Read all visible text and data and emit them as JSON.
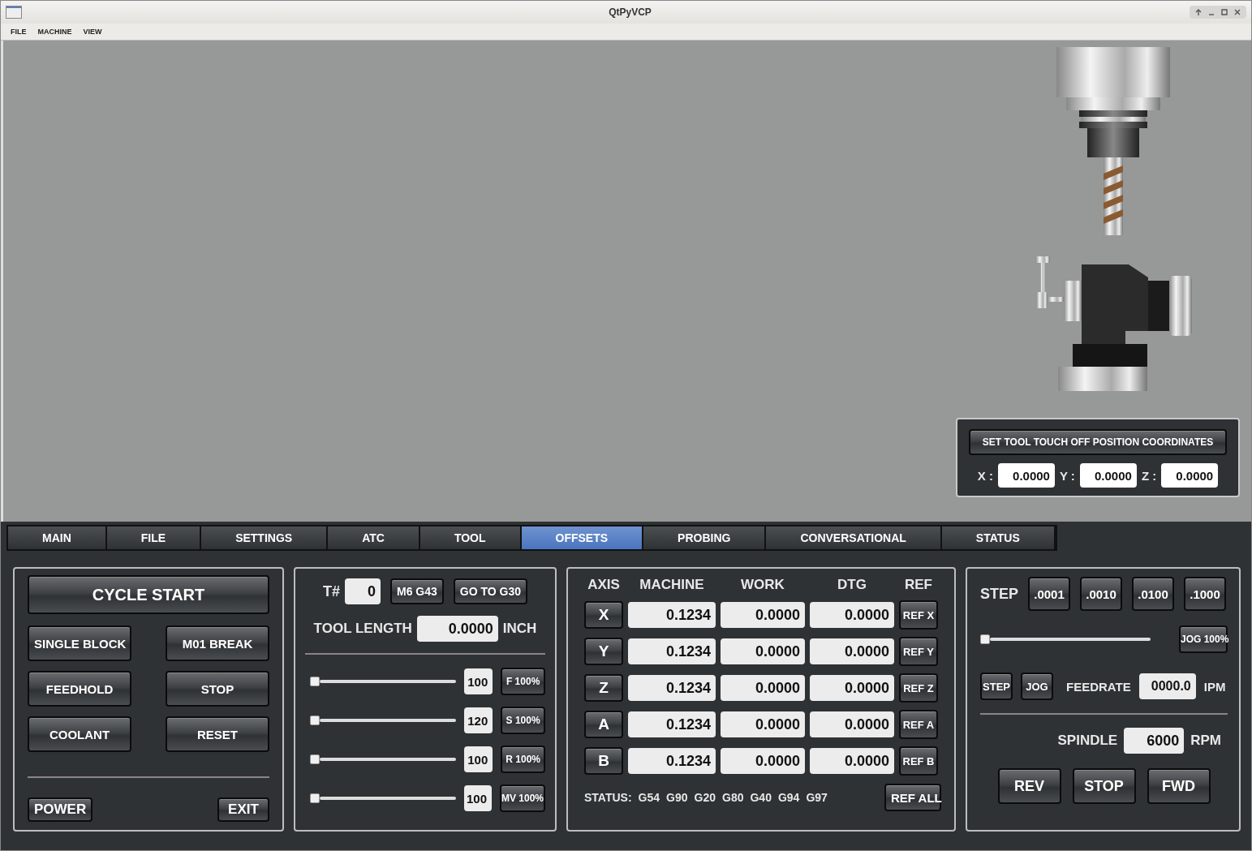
{
  "window": {
    "title": "QtPyVCP"
  },
  "menu": [
    "FILE",
    "MACHINE",
    "VIEW"
  ],
  "touch_off": {
    "button": "SET TOOL TOUCH OFF POSITION COORDINATES",
    "fields": [
      {
        "label": "X :",
        "value": "0.0000"
      },
      {
        "label": "Y :",
        "value": "0.0000"
      },
      {
        "label": "Z :",
        "value": "0.0000"
      }
    ]
  },
  "tabs": [
    {
      "label": "MAIN",
      "selected": false
    },
    {
      "label": "FILE",
      "selected": false
    },
    {
      "label": "SETTINGS",
      "selected": false
    },
    {
      "label": "ATC",
      "selected": false
    },
    {
      "label": "TOOL",
      "selected": false
    },
    {
      "label": "OFFSETS",
      "selected": true
    },
    {
      "label": "PROBING",
      "selected": false
    },
    {
      "label": "CONVERSATIONAL",
      "selected": false
    },
    {
      "label": "STATUS",
      "selected": false
    }
  ],
  "control_panel": {
    "cycle_start": "CYCLE START",
    "buttons": [
      "SINGLE BLOCK",
      "M01 BREAK",
      "FEEDHOLD",
      "STOP",
      "COOLANT",
      "RESET"
    ],
    "power": "POWER",
    "exit": "EXIT"
  },
  "tool_panel": {
    "tool_label": "T#",
    "tool_number": "0",
    "buttons": [
      "M6 G43",
      "GO TO G30"
    ],
    "length_label": "TOOL LENGTH",
    "length_value": "0.0000",
    "length_unit": "INCH",
    "overrides": [
      {
        "level": 0,
        "value": "100",
        "button": "F 100%"
      },
      {
        "level": 0,
        "value": "120",
        "button": "S 100%"
      },
      {
        "level": 0,
        "value": "100",
        "button": "R 100%"
      },
      {
        "level": 0,
        "value": "100",
        "button": "MV 100%"
      }
    ]
  },
  "dro": {
    "columns": [
      "AXIS",
      "MACHINE",
      "WORK",
      "DTG",
      "REF"
    ],
    "rows": [
      {
        "axis": "X",
        "machine": "0.1234",
        "work": "0.0000",
        "dtg": "0.0000",
        "ref": "REF X"
      },
      {
        "axis": "Y",
        "machine": "0.1234",
        "work": "0.0000",
        "dtg": "0.0000",
        "ref": "REF Y"
      },
      {
        "axis": "Z",
        "machine": "0.1234",
        "work": "0.0000",
        "dtg": "0.0000",
        "ref": "REF Z"
      },
      {
        "axis": "A",
        "machine": "0.1234",
        "work": "0.0000",
        "dtg": "0.0000",
        "ref": "REF A"
      },
      {
        "axis": "B",
        "machine": "0.1234",
        "work": "0.0000",
        "dtg": "0.0000",
        "ref": "REF B"
      }
    ],
    "status_label": "STATUS:",
    "codes": [
      "G54",
      "G90",
      "G20",
      "G80",
      "G40",
      "G94",
      "G97"
    ],
    "ref_all": "REF ALL"
  },
  "jog_panel": {
    "step_label": "STEP",
    "steps": [
      ".0001",
      ".0010",
      ".0100",
      ".1000"
    ],
    "jog_slider": {
      "level": 0
    },
    "jog_button": "JOG 100%",
    "mode_buttons": [
      "STEP",
      "JOG"
    ],
    "feedrate_label": "FEEDRATE",
    "feedrate_value": "0000.0",
    "feedrate_unit": "IPM",
    "spindle_label": "SPINDLE",
    "spindle_value": "6000",
    "spindle_unit": "RPM",
    "spindle_buttons": [
      "REV",
      "STOP",
      "FWD"
    ]
  }
}
